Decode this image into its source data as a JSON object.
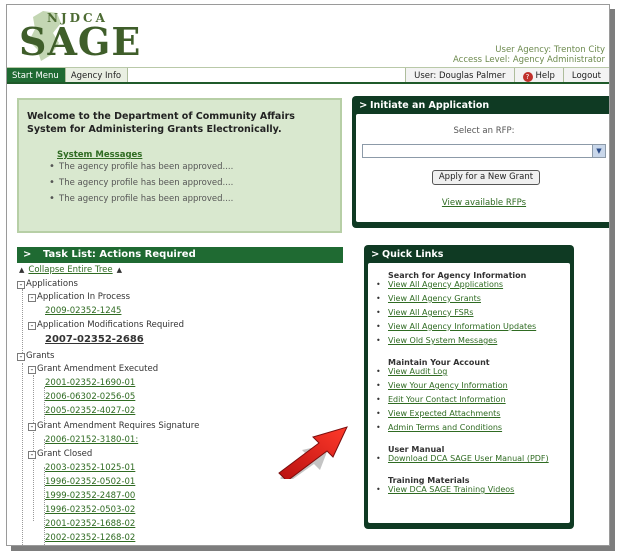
{
  "header": {
    "logo_small": "NJDCA",
    "logo_big": "SAGE",
    "user_agency": "User Agency: Trenton City",
    "access_level": "Access Level: Agency Administrator"
  },
  "nav": {
    "tabs": [
      "Start Menu",
      "Agency Info"
    ],
    "user": "User: Douglas Palmer",
    "help": "Help",
    "logout": "Logout"
  },
  "welcome": {
    "title": "Welcome to the Department of Community Affairs System for Administering Grants Electronically.",
    "system_messages_label": "System Messages",
    "messages": [
      "The agency profile has been approved....",
      "The agency profile has been approved....",
      "The agency profile has been approved...."
    ]
  },
  "initiate": {
    "title": "Initiate an Application",
    "select_label": "Select an RFP:",
    "select_value": "",
    "apply_button": "Apply for a New Grant",
    "view_rfps": "View available RFPs"
  },
  "tasks": {
    "title": "Task List: Actions Required",
    "collapse": "Collapse Entire Tree",
    "applications": "Applications",
    "app_in_process": "Application In Process",
    "app_in_process_items": [
      "2009-02352-1245"
    ],
    "app_mod_required": "Application Modifications Required",
    "app_mod_items": [
      "2007-02352-2686"
    ],
    "grants": "Grants",
    "amend_executed": "Grant Amendment Executed",
    "amend_executed_items": [
      "2001-02352-1690-01",
      "2006-06302-0256-05",
      "2005-02352-4027-02"
    ],
    "amend_requires_signature": "Grant Amendment Requires Signature",
    "amend_signature_items": [
      "2006-02152-3180-01:"
    ],
    "grant_closed": "Grant Closed",
    "grant_closed_items": [
      "2003-02352-1025-01",
      "1996-02352-0502-01",
      "1999-02352-2487-00",
      "1996-02352-0503-02",
      "2001-02352-1688-02",
      "2002-02352-1268-02"
    ]
  },
  "quicklinks": {
    "title": "Quick Links",
    "search_heading": "Search for Agency Information",
    "search_links": [
      "View All Agency Applications",
      "View All Agency Grants",
      "View All Agency FSRs",
      "View All Agency Information Updates",
      "View Old System Messages"
    ],
    "maintain_heading": "Maintain Your Account",
    "maintain_links": [
      "View Audit Log",
      "View Your Agency Information",
      "Edit Your Contact Information",
      "View Expected Attachments",
      "Admin Terms and Conditions"
    ],
    "manual_heading": "User Manual",
    "manual_link": "Download DCA SAGE User Manual (PDF)",
    "training_heading": "Training Materials",
    "training_link": "View DCA SAGE Training Videos"
  },
  "colors": {
    "nav_green": "#1f6a32",
    "panel_dark": "#0f3a23",
    "link_green": "#2f6b22",
    "welcome_bg": "#d9e8cf",
    "arrow_red": "#e02020"
  }
}
